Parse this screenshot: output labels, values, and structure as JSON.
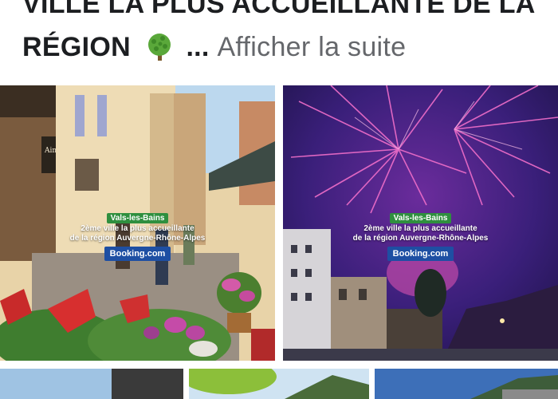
{
  "post": {
    "line1": "VILLE LA PLUS ACCUEILLANTE DE LA",
    "line2": "RÉGION",
    "ellipsis": "...",
    "see_more": "Afficher la suite",
    "emoji_icon": "broccoli-tree-icon"
  },
  "photos": [
    {
      "tag": "Vals-les-Bains",
      "caption_line1": "2ème ville la plus accueillante",
      "caption_line2": "de la région Auvergne-Rhône-Alpes",
      "brand": "Booking.com",
      "shop_sign": "Aimée"
    },
    {
      "tag": "Vals-les-Bains",
      "caption_line1": "2ème ville la plus accueillante",
      "caption_line2": "de la région Auvergne-Rhône-Alpes",
      "brand": "Booking.com"
    }
  ],
  "colors": {
    "text": "#1c1e21",
    "see_more": "#65676b",
    "tag_green": "#2f8f3f",
    "booking_blue": "#1e4fa3"
  }
}
